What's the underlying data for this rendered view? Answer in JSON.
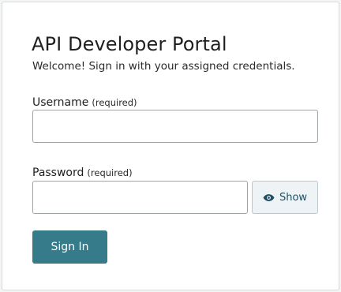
{
  "login": {
    "title": "API Developer Portal",
    "subtitle": "Welcome! Sign in with your assigned credentials.",
    "username": {
      "label": "Username",
      "required_note": "(required)",
      "value": "",
      "placeholder": ""
    },
    "password": {
      "label": "Password",
      "required_note": "(required)",
      "value": "",
      "placeholder": ""
    },
    "show_button": {
      "label": "Show",
      "icon": "eye-icon"
    },
    "submit_button": {
      "label": "Sign In"
    }
  },
  "colors": {
    "accent": "#357b89",
    "show_text": "#1e4f64",
    "show_bg": "#eef3f6"
  }
}
